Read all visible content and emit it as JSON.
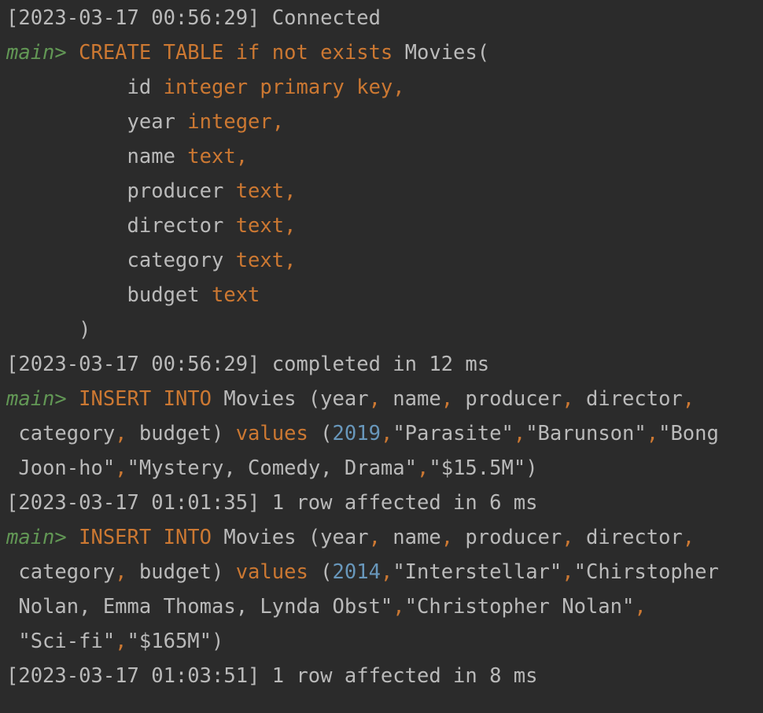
{
  "console": {
    "lines": [
      {
        "tokens": [
          {
            "t": "ts",
            "v": "[2023-03-17 00:56:29] Connected"
          }
        ]
      },
      {
        "tokens": [
          {
            "t": "prompt",
            "v": "main> "
          },
          {
            "t": "kw",
            "v": "CREATE TABLE if not exists "
          },
          {
            "t": "id",
            "v": "Movies("
          }
        ]
      },
      {
        "tokens": [
          {
            "t": "id",
            "v": "          id "
          },
          {
            "t": "kw",
            "v": "integer primary key,"
          }
        ]
      },
      {
        "tokens": [
          {
            "t": "id",
            "v": "          year "
          },
          {
            "t": "kw",
            "v": "integer,"
          }
        ]
      },
      {
        "tokens": [
          {
            "t": "id",
            "v": "          name "
          },
          {
            "t": "kw",
            "v": "text,"
          }
        ]
      },
      {
        "tokens": [
          {
            "t": "id",
            "v": "          producer "
          },
          {
            "t": "kw",
            "v": "text,"
          }
        ]
      },
      {
        "tokens": [
          {
            "t": "id",
            "v": "          director "
          },
          {
            "t": "kw",
            "v": "text,"
          }
        ]
      },
      {
        "tokens": [
          {
            "t": "id",
            "v": "          category "
          },
          {
            "t": "kw",
            "v": "text,"
          }
        ]
      },
      {
        "tokens": [
          {
            "t": "id",
            "v": "          budget "
          },
          {
            "t": "kw",
            "v": "text"
          }
        ]
      },
      {
        "tokens": [
          {
            "t": "id",
            "v": "      )"
          }
        ]
      },
      {
        "tokens": [
          {
            "t": "ts",
            "v": "[2023-03-17 00:56:29] completed in 12 ms"
          }
        ]
      },
      {
        "tokens": [
          {
            "t": "prompt",
            "v": "main> "
          },
          {
            "t": "kw",
            "v": "INSERT INTO "
          },
          {
            "t": "id",
            "v": "Movies (year"
          },
          {
            "t": "punc",
            "v": ","
          },
          {
            "t": "id",
            "v": " name"
          },
          {
            "t": "punc",
            "v": ","
          },
          {
            "t": "id",
            "v": " producer"
          },
          {
            "t": "punc",
            "v": ","
          },
          {
            "t": "id",
            "v": " director"
          },
          {
            "t": "punc",
            "v": ","
          }
        ]
      },
      {
        "tokens": [
          {
            "t": "id",
            "v": " category"
          },
          {
            "t": "punc",
            "v": ","
          },
          {
            "t": "id",
            "v": " budget) "
          },
          {
            "t": "kw",
            "v": "values "
          },
          {
            "t": "id",
            "v": "("
          },
          {
            "t": "num",
            "v": "2019"
          },
          {
            "t": "punc",
            "v": ","
          },
          {
            "t": "str",
            "v": "\"Parasite\""
          },
          {
            "t": "punc",
            "v": ","
          },
          {
            "t": "str",
            "v": "\"Barunson\""
          },
          {
            "t": "punc",
            "v": ","
          },
          {
            "t": "str",
            "v": "\"Bong"
          }
        ]
      },
      {
        "tokens": [
          {
            "t": "str",
            "v": " Joon-ho\""
          },
          {
            "t": "punc",
            "v": ","
          },
          {
            "t": "str",
            "v": "\"Mystery, Comedy, Drama\""
          },
          {
            "t": "punc",
            "v": ","
          },
          {
            "t": "str",
            "v": "\"$15.5M\""
          },
          {
            "t": "id",
            "v": ")"
          }
        ]
      },
      {
        "tokens": [
          {
            "t": "ts",
            "v": "[2023-03-17 01:01:35] 1 row affected in 6 ms"
          }
        ]
      },
      {
        "tokens": [
          {
            "t": "prompt",
            "v": "main> "
          },
          {
            "t": "kw",
            "v": "INSERT INTO "
          },
          {
            "t": "id",
            "v": "Movies (year"
          },
          {
            "t": "punc",
            "v": ","
          },
          {
            "t": "id",
            "v": " name"
          },
          {
            "t": "punc",
            "v": ","
          },
          {
            "t": "id",
            "v": " producer"
          },
          {
            "t": "punc",
            "v": ","
          },
          {
            "t": "id",
            "v": " director"
          },
          {
            "t": "punc",
            "v": ","
          }
        ]
      },
      {
        "tokens": [
          {
            "t": "id",
            "v": " category"
          },
          {
            "t": "punc",
            "v": ","
          },
          {
            "t": "id",
            "v": " budget) "
          },
          {
            "t": "kw",
            "v": "values "
          },
          {
            "t": "id",
            "v": "("
          },
          {
            "t": "num",
            "v": "2014"
          },
          {
            "t": "punc",
            "v": ","
          },
          {
            "t": "str",
            "v": "\"Interstellar\""
          },
          {
            "t": "punc",
            "v": ","
          },
          {
            "t": "str",
            "v": "\"Chirstopher"
          }
        ]
      },
      {
        "tokens": [
          {
            "t": "str",
            "v": " Nolan, Emma Thomas, Lynda Obst\""
          },
          {
            "t": "punc",
            "v": ","
          },
          {
            "t": "str",
            "v": "\"Christopher Nolan\""
          },
          {
            "t": "punc",
            "v": ","
          }
        ]
      },
      {
        "tokens": [
          {
            "t": "str",
            "v": " \"Sci-fi\""
          },
          {
            "t": "punc",
            "v": ","
          },
          {
            "t": "str",
            "v": "\"$165M\""
          },
          {
            "t": "id",
            "v": ")"
          }
        ]
      },
      {
        "tokens": [
          {
            "t": "ts",
            "v": "[2023-03-17 01:03:51] 1 row affected in 8 ms"
          }
        ]
      }
    ]
  },
  "colors": {
    "background": "#2b2b2b",
    "text": "#bababa",
    "prompt": "#629755",
    "keyword": "#cc7832",
    "number": "#6897bb"
  }
}
